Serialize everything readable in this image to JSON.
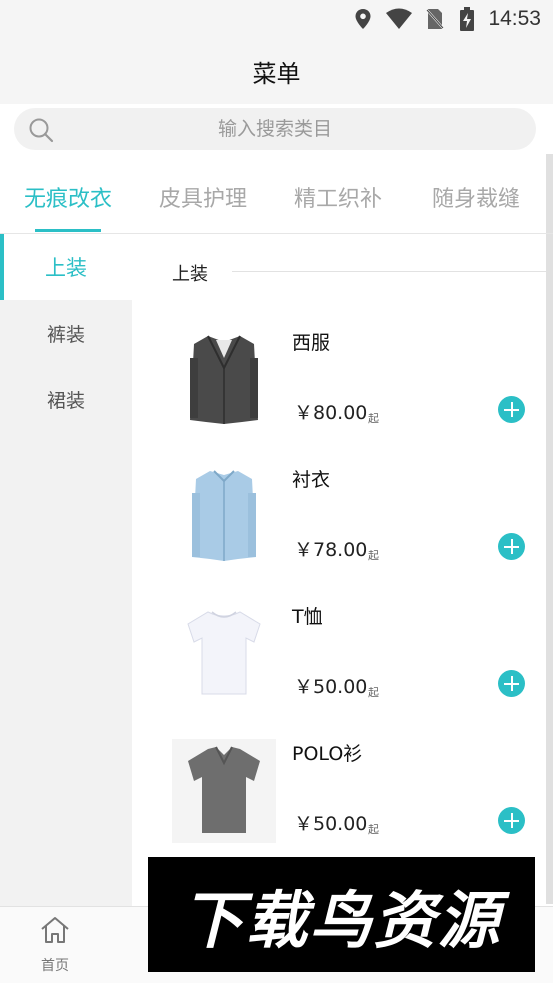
{
  "status_bar": {
    "time": "14:53",
    "icons": [
      "location-icon",
      "wifi-icon",
      "no-sim-icon",
      "battery-charging-icon"
    ]
  },
  "header": {
    "title": "菜单"
  },
  "search": {
    "placeholder": "输入搜索类目",
    "icon": "search-icon"
  },
  "tabs": [
    {
      "label": "无痕改衣",
      "active": true
    },
    {
      "label": "皮具护理",
      "active": false
    },
    {
      "label": "精工织补",
      "active": false
    },
    {
      "label": "随身裁缝",
      "active": false
    }
  ],
  "sidebar": {
    "items": [
      {
        "label": "上装",
        "active": true
      },
      {
        "label": "裤装",
        "active": false
      },
      {
        "label": "裙装",
        "active": false
      }
    ]
  },
  "content": {
    "section_title": "上装",
    "products": [
      {
        "name": "西服",
        "price": "￥80.00",
        "suffix": "起",
        "image": "suit-jacket"
      },
      {
        "name": "衬衣",
        "price": "￥78.00",
        "suffix": "起",
        "image": "dress-shirt"
      },
      {
        "name": "T恤",
        "price": "￥50.00",
        "suffix": "起",
        "image": "t-shirt"
      },
      {
        "name": "POLO衫",
        "price": "￥50.00",
        "suffix": "起",
        "image": "polo-shirt"
      }
    ]
  },
  "bottom_nav": {
    "home_label": "首页",
    "home_icon": "home-icon"
  },
  "watermark": {
    "text": "下载鸟资源"
  },
  "colors": {
    "accent": "#2bbfc6",
    "background": "#f5f5f5"
  }
}
